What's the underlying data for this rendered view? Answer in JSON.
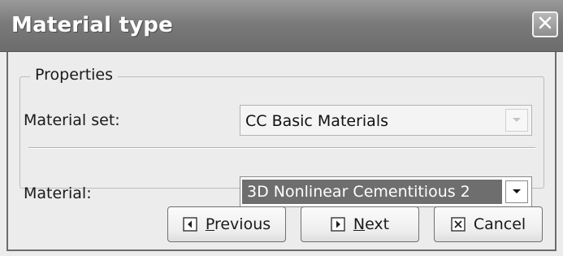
{
  "window": {
    "title": "Material type",
    "close_icon": "close-icon"
  },
  "properties": {
    "group_title": "Properties",
    "material_set": {
      "label": "Material set:",
      "value": "CC Basic Materials",
      "enabled": false
    },
    "material": {
      "label": "Material:",
      "value": "3D Nonlinear Cementitious 2",
      "enabled": true
    }
  },
  "buttons": {
    "previous": {
      "mnemonic": "P",
      "rest": "revious",
      "icon": "arrow-left-icon"
    },
    "next": {
      "mnemonic": "N",
      "rest": "ext",
      "icon": "arrow-right-icon"
    },
    "cancel": {
      "label": "Cancel",
      "icon": "x-box-icon"
    }
  }
}
